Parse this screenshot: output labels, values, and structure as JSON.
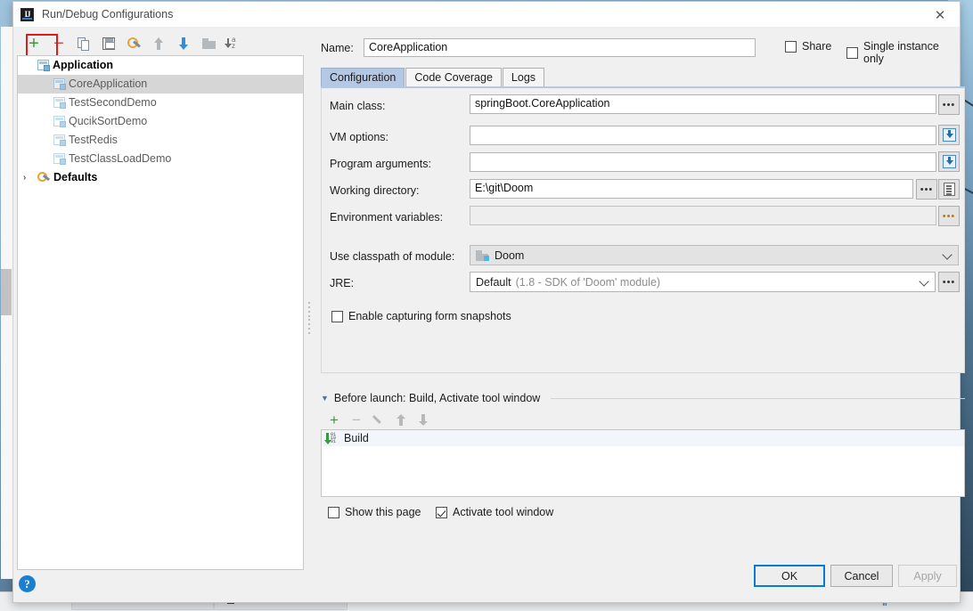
{
  "window": {
    "title": "Run/Debug Configurations",
    "app_icon": "intellij-idea-icon",
    "close_label": "✕"
  },
  "toolbar": {
    "buttons": [
      {
        "name": "add-configuration-button",
        "icon": "plus-icon",
        "glyph": "+",
        "highlighted": true
      },
      {
        "name": "remove-configuration-button",
        "icon": "minus-icon",
        "glyph": "−"
      },
      {
        "name": "copy-configuration-button",
        "icon": "copy-icon"
      },
      {
        "name": "save-configuration-button",
        "icon": "save-icon"
      },
      {
        "name": "edit-defaults-button",
        "icon": "wrench-icon"
      },
      {
        "name": "move-up-button",
        "icon": "arrow-up-icon"
      },
      {
        "name": "move-down-button",
        "icon": "arrow-down-icon"
      },
      {
        "name": "create-folder-button",
        "icon": "folder-icon"
      },
      {
        "name": "sort-configurations-button",
        "icon": "sort-az-icon"
      }
    ]
  },
  "tree": {
    "group_label": "Application",
    "items": [
      {
        "label": "CoreApplication",
        "selected": true
      },
      {
        "label": "TestSecondDemo",
        "selected": false
      },
      {
        "label": "QucikSortDemo",
        "selected": false
      },
      {
        "label": "TestRedis",
        "selected": false
      },
      {
        "label": "TestClassLoadDemo",
        "selected": false
      }
    ],
    "defaults_label": "Defaults",
    "defaults_twisty": "›"
  },
  "form": {
    "name_label": "Name:",
    "name_value": "CoreApplication",
    "share": {
      "label": "Share",
      "checked": false
    },
    "single_instance": {
      "label": "Single instance only",
      "checked": false
    },
    "tabs": [
      {
        "label": "Configuration",
        "active": true
      },
      {
        "label": "Code Coverage",
        "active": false
      },
      {
        "label": "Logs",
        "active": false
      }
    ],
    "fields": {
      "main_class": {
        "label": "Main class:",
        "value": "springBoot.CoreApplication",
        "button": "browse-dots"
      },
      "vm_options": {
        "label": "VM options:",
        "value": "",
        "button": "expand-insert"
      },
      "program_arguments": {
        "label": "Program arguments:",
        "value": "",
        "button": "expand-insert"
      },
      "working_directory": {
        "label": "Working directory:",
        "value": "E:\\git\\Doom",
        "button": "browse-dots",
        "button2": "macros-list"
      },
      "environment_variables": {
        "label": "Environment variables:",
        "value": "",
        "button": "browse-dots",
        "readonly": true
      },
      "use_classpath_of_module": {
        "label": "Use classpath of module:",
        "value": "Doom"
      },
      "jre": {
        "label": "JRE:",
        "value": "Default",
        "value_detail": "(1.8 - SDK of 'Doom' module)",
        "button": "browse-dots"
      }
    },
    "enable_snapshots": {
      "label": "Enable capturing form snapshots",
      "checked": false
    }
  },
  "before_launch": {
    "twisty": "▼",
    "title": "Before launch: Build, Activate tool window",
    "toolbar": [
      {
        "name": "add-task-button",
        "icon": "plus-icon",
        "glyph": "+",
        "enabled": true
      },
      {
        "name": "remove-task-button",
        "icon": "minus-icon",
        "glyph": "−",
        "enabled": false
      },
      {
        "name": "edit-task-button",
        "icon": "pencil-icon",
        "enabled": false
      },
      {
        "name": "move-task-up-button",
        "icon": "arrow-up-icon",
        "enabled": false
      },
      {
        "name": "move-task-down-button",
        "icon": "arrow-down-icon",
        "enabled": false
      }
    ],
    "tasks": [
      {
        "label": "Build",
        "icon": "build-icon"
      }
    ],
    "show_this_page": {
      "label": "Show this page",
      "checked": false
    },
    "activate_tool_window": {
      "label": "Activate tool window",
      "checked": true
    }
  },
  "footer": {
    "help_glyph": "?",
    "ok_label": "OK",
    "cancel_label": "Cancel",
    "apply_label": "Apply",
    "apply_enabled": false
  },
  "colors": {
    "accent_blue": "#0a7bd4",
    "tab_active": "#b4c8e3",
    "highlight_red": "#e01b1b",
    "plus_green": "#3c9a3c",
    "minus_red": "#c15050"
  }
}
